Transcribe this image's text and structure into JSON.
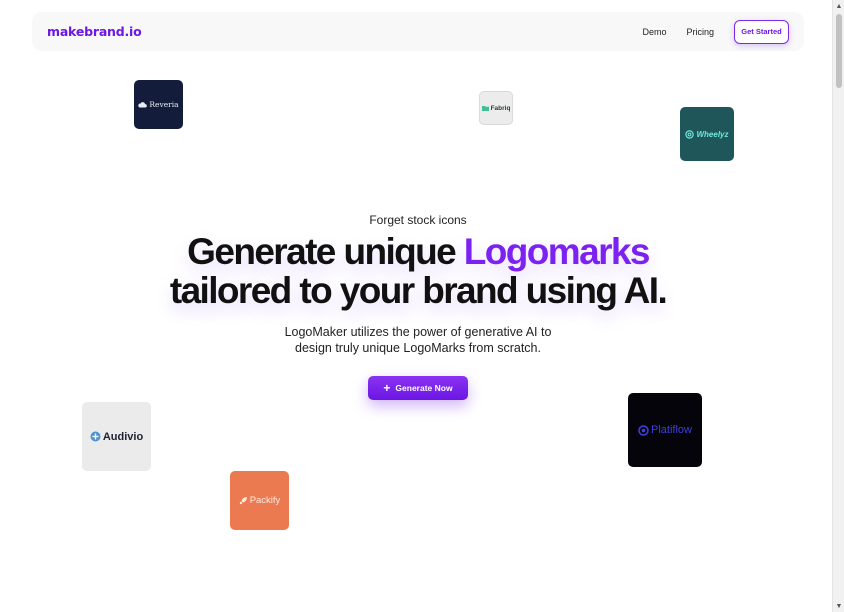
{
  "nav": {
    "brand": "makebrand.io",
    "links": [
      "Demo",
      "Pricing"
    ],
    "cta_label": "Get Started"
  },
  "hero": {
    "eyebrow": "Forget stock icons",
    "headline_part1": "Generate unique ",
    "headline_accent": "Logomarks",
    "headline_part2": "tailored to your brand using AI.",
    "subtext": "LogoMaker utilizes the power of generative AI to design truly unique LogoMarks from scratch.",
    "cta_label": "Generate Now",
    "cta_icon": "plus-icon"
  },
  "logos": {
    "reveria": "Reveria",
    "fabriq": "Fabriq",
    "wheelyz": "Wheelyz",
    "audivio": "Audivio",
    "packify": "Packify",
    "platiflow": "Platiflow"
  },
  "colors": {
    "accent": "#7c22f0",
    "brand": "#6d16e8"
  }
}
